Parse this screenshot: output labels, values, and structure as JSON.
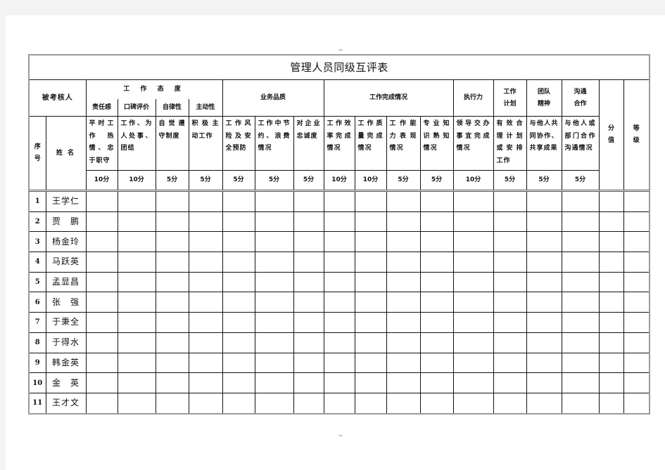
{
  "title": "管理人员同级互评表",
  "header": {
    "evaluatee_label": "被考核人",
    "index_label": "序号",
    "index_chars": [
      "序",
      "号"
    ],
    "name_label": "姓 名",
    "groups": [
      {
        "label": "工 作 态 度",
        "subs": [
          "责任感",
          "口碑评价",
          "自律性",
          "主动性"
        ]
      },
      {
        "label": "业务品质"
      },
      {
        "label": "工作完成情况"
      },
      {
        "label": "执行力"
      },
      {
        "label": "工作计划",
        "lines": [
          "工作",
          "计划"
        ]
      },
      {
        "label": "团队精神",
        "lines": [
          "团队",
          "精神"
        ]
      },
      {
        "label": "沟通合作",
        "lines": [
          "沟通",
          "合作"
        ]
      }
    ],
    "score_label": [
      "分",
      "值"
    ],
    "grade_label": [
      "等",
      "级"
    ],
    "criteria": [
      {
        "desc": "平时工作热情、忠于职守",
        "points": "10分"
      },
      {
        "desc": "工作、为人处事、团结",
        "points": "10分"
      },
      {
        "desc": "自觉遵守制度",
        "points": "5分"
      },
      {
        "desc": "积极主动工作",
        "points": "5分"
      },
      {
        "desc": "工作风险及安全预防",
        "points": "5分"
      },
      {
        "desc": "工作中节约、浪费情况",
        "points": "5分"
      },
      {
        "desc": "对企业忠诚度",
        "points": "5分"
      },
      {
        "desc": "工作效率完成情况",
        "points": "10分"
      },
      {
        "desc": "工作质量完成情况",
        "points": "10分"
      },
      {
        "desc": "工作能力表现情况",
        "points": "5分"
      },
      {
        "desc": "专业知识熟知情况",
        "points": "5分"
      },
      {
        "desc": "领导交办事宜完成情况",
        "points": "10分"
      },
      {
        "desc": "有效合理计划或安排工作",
        "points": "5分"
      },
      {
        "desc": "与他人共同协作、共享成果",
        "points": "5分"
      },
      {
        "desc": "与他人或部门合作沟通情况",
        "points": "5分"
      }
    ]
  },
  "rows": [
    {
      "index": "1",
      "name": "王学仁"
    },
    {
      "index": "2",
      "name": "贾　鹏"
    },
    {
      "index": "3",
      "name": "杨金玲"
    },
    {
      "index": "4",
      "name": "马跃英"
    },
    {
      "index": "5",
      "name": "孟显昌"
    },
    {
      "index": "6",
      "name": "张　强"
    },
    {
      "index": "7",
      "name": "于秉全"
    },
    {
      "index": "8",
      "name": "于得水"
    },
    {
      "index": "9",
      "name": "韩金英"
    },
    {
      "index": "10",
      "name": "金　英"
    },
    {
      "index": "11",
      "name": "王才文"
    }
  ]
}
